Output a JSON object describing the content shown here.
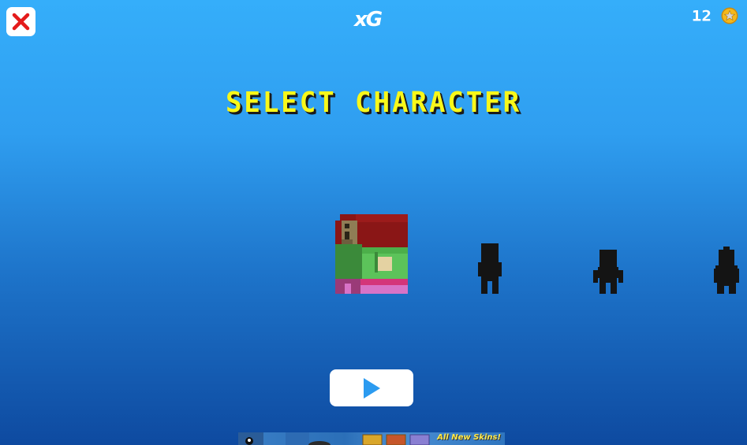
{
  "header": {
    "logo_text": "xG",
    "coin_count": "12",
    "close_icon": "close-x-icon",
    "coin_icon": "star-coin-icon"
  },
  "title": "SELECT CHARACTER",
  "characters": [
    {
      "icon": "red-haired-girl-character",
      "state": "selected"
    },
    {
      "icon": "locked-character-silhouette",
      "state": "locked"
    },
    {
      "icon": "locked-character-silhouette",
      "state": "locked"
    },
    {
      "icon": "locked-character-silhouette",
      "state": "locked"
    }
  ],
  "play": {
    "icon": "play-icon"
  },
  "ad": {
    "text": "All New Skins!"
  },
  "colors": {
    "title_yellow": "#f8f81a",
    "close_red": "#e41b1b",
    "play_blue": "#2c9bf0",
    "coin_gold": "#f4b81c",
    "sky_top": "#35aefa",
    "sky_bottom": "#0e4aa0",
    "silhouette": "#141414"
  }
}
